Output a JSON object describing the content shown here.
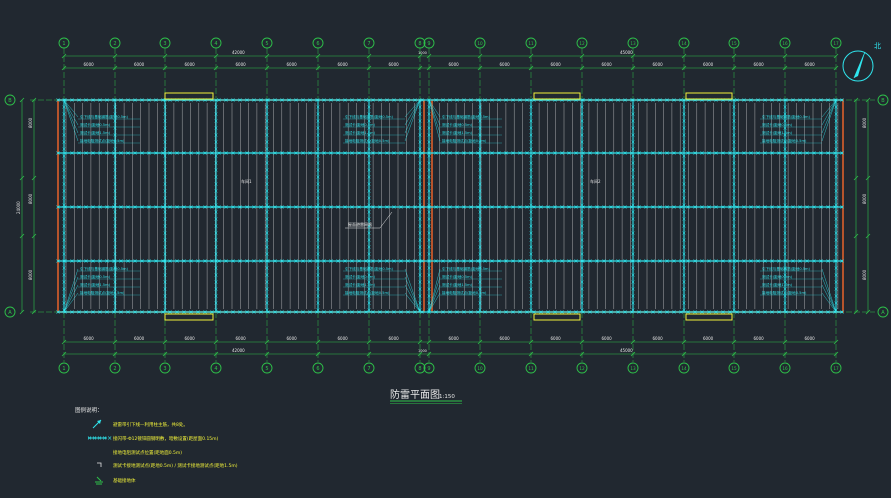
{
  "drawing": {
    "title": "防雷平面图",
    "scale": "1:150",
    "top_total_left": "42000",
    "top_total_right": "45000",
    "joint_dim": "1000",
    "bottom_total_left": "42000",
    "bottom_total_right": "45000",
    "right_total": "24000",
    "left_total": "24000",
    "compass_label": "北"
  },
  "grid_columns": [
    "1",
    "2",
    "3",
    "4",
    "5",
    "6",
    "7",
    "8",
    "9",
    "10",
    "11",
    "12",
    "13",
    "14",
    "15",
    "16",
    "17"
  ],
  "grid_rows": [
    "B",
    "A"
  ],
  "top_spans": [
    "6000",
    "6000",
    "6000",
    "6000",
    "6000",
    "6000",
    "6000",
    "6000",
    "6000",
    "6000",
    "6000",
    "6000",
    "6000",
    "6000",
    "6000"
  ],
  "bottom_spans": [
    "6000",
    "6000",
    "6000",
    "6000",
    "6000",
    "6000",
    "6000",
    "6000",
    "6000",
    "6000",
    "6000",
    "6000",
    "6000",
    "6000",
    "6000"
  ],
  "left_spans": [
    "8000",
    "8000",
    "8000"
  ],
  "right_spans": [
    "8000",
    "8000",
    "8000"
  ],
  "zone_labels": [
    "车间1",
    "车间2"
  ],
  "center_note": "屋面避雷网格",
  "callout_lines": [
    "引下线与基础钢筋(距地0.5m)",
    "测试卡(距地0.5m)",
    "测试卡(距地1.5m)",
    "接地电阻测试点(距地0.5m)"
  ],
  "legend": {
    "title": "图例说明：",
    "items": [
      {
        "icon": "arrow-icon",
        "text": "避雷带引下线—利用柱主筋，共8处。"
      },
      {
        "icon": "mesh-icon",
        "text": "接闪带-Φ12镀锌圆钢明敷，暗敷设置(距屋面0.15m)"
      },
      {
        "icon": "none",
        "text": "接地电阻测试点位置(距地面0.5m)"
      },
      {
        "icon": "corner-icon",
        "text": "测试卡接地测试点(距地0.5m) / 测试卡接地测试点(距地1.5m)"
      },
      {
        "icon": "ground-icon",
        "text": "基础接地体"
      }
    ]
  },
  "colors": {
    "background": "#212830",
    "grid_cyan": "#2fe6ee",
    "axis_green": "#2ec24a",
    "wall_orange": "#e8622a",
    "panel_white": "#e8e8e8",
    "red_axis": "#d8323a",
    "yellow": "#f2f23a"
  }
}
